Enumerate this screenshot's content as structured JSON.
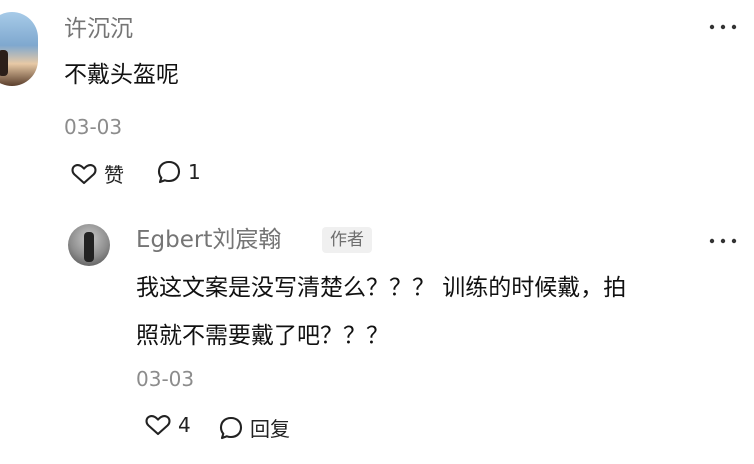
{
  "top_comment": {
    "username": "许沉沉",
    "content": "不戴头盔呢",
    "timestamp": "03-03",
    "like_label": "赞",
    "comment_count": "1",
    "icons": {
      "avatar": "user-avatar",
      "more": "more-dots-icon",
      "like": "heart-icon",
      "comment": "comment-bubble-icon"
    }
  },
  "reply_comment": {
    "username": "Egbert刘宸翰",
    "author_badge": "作者",
    "content_lines": [
      "我这文案是没写清楚么？？？ 训练的时候戴，拍",
      "照就不需要戴了吧？？？"
    ],
    "timestamp": "03-03",
    "like_count": "4",
    "reply_label": "回复",
    "icons": {
      "avatar": "user-avatar",
      "more": "more-dots-icon",
      "like": "heart-icon",
      "reply": "comment-bubble-icon"
    }
  },
  "colors": {
    "username": "#757575",
    "text": "#111111",
    "timestamp": "#8c8c8c",
    "badge_bg": "#f0f0f0"
  }
}
